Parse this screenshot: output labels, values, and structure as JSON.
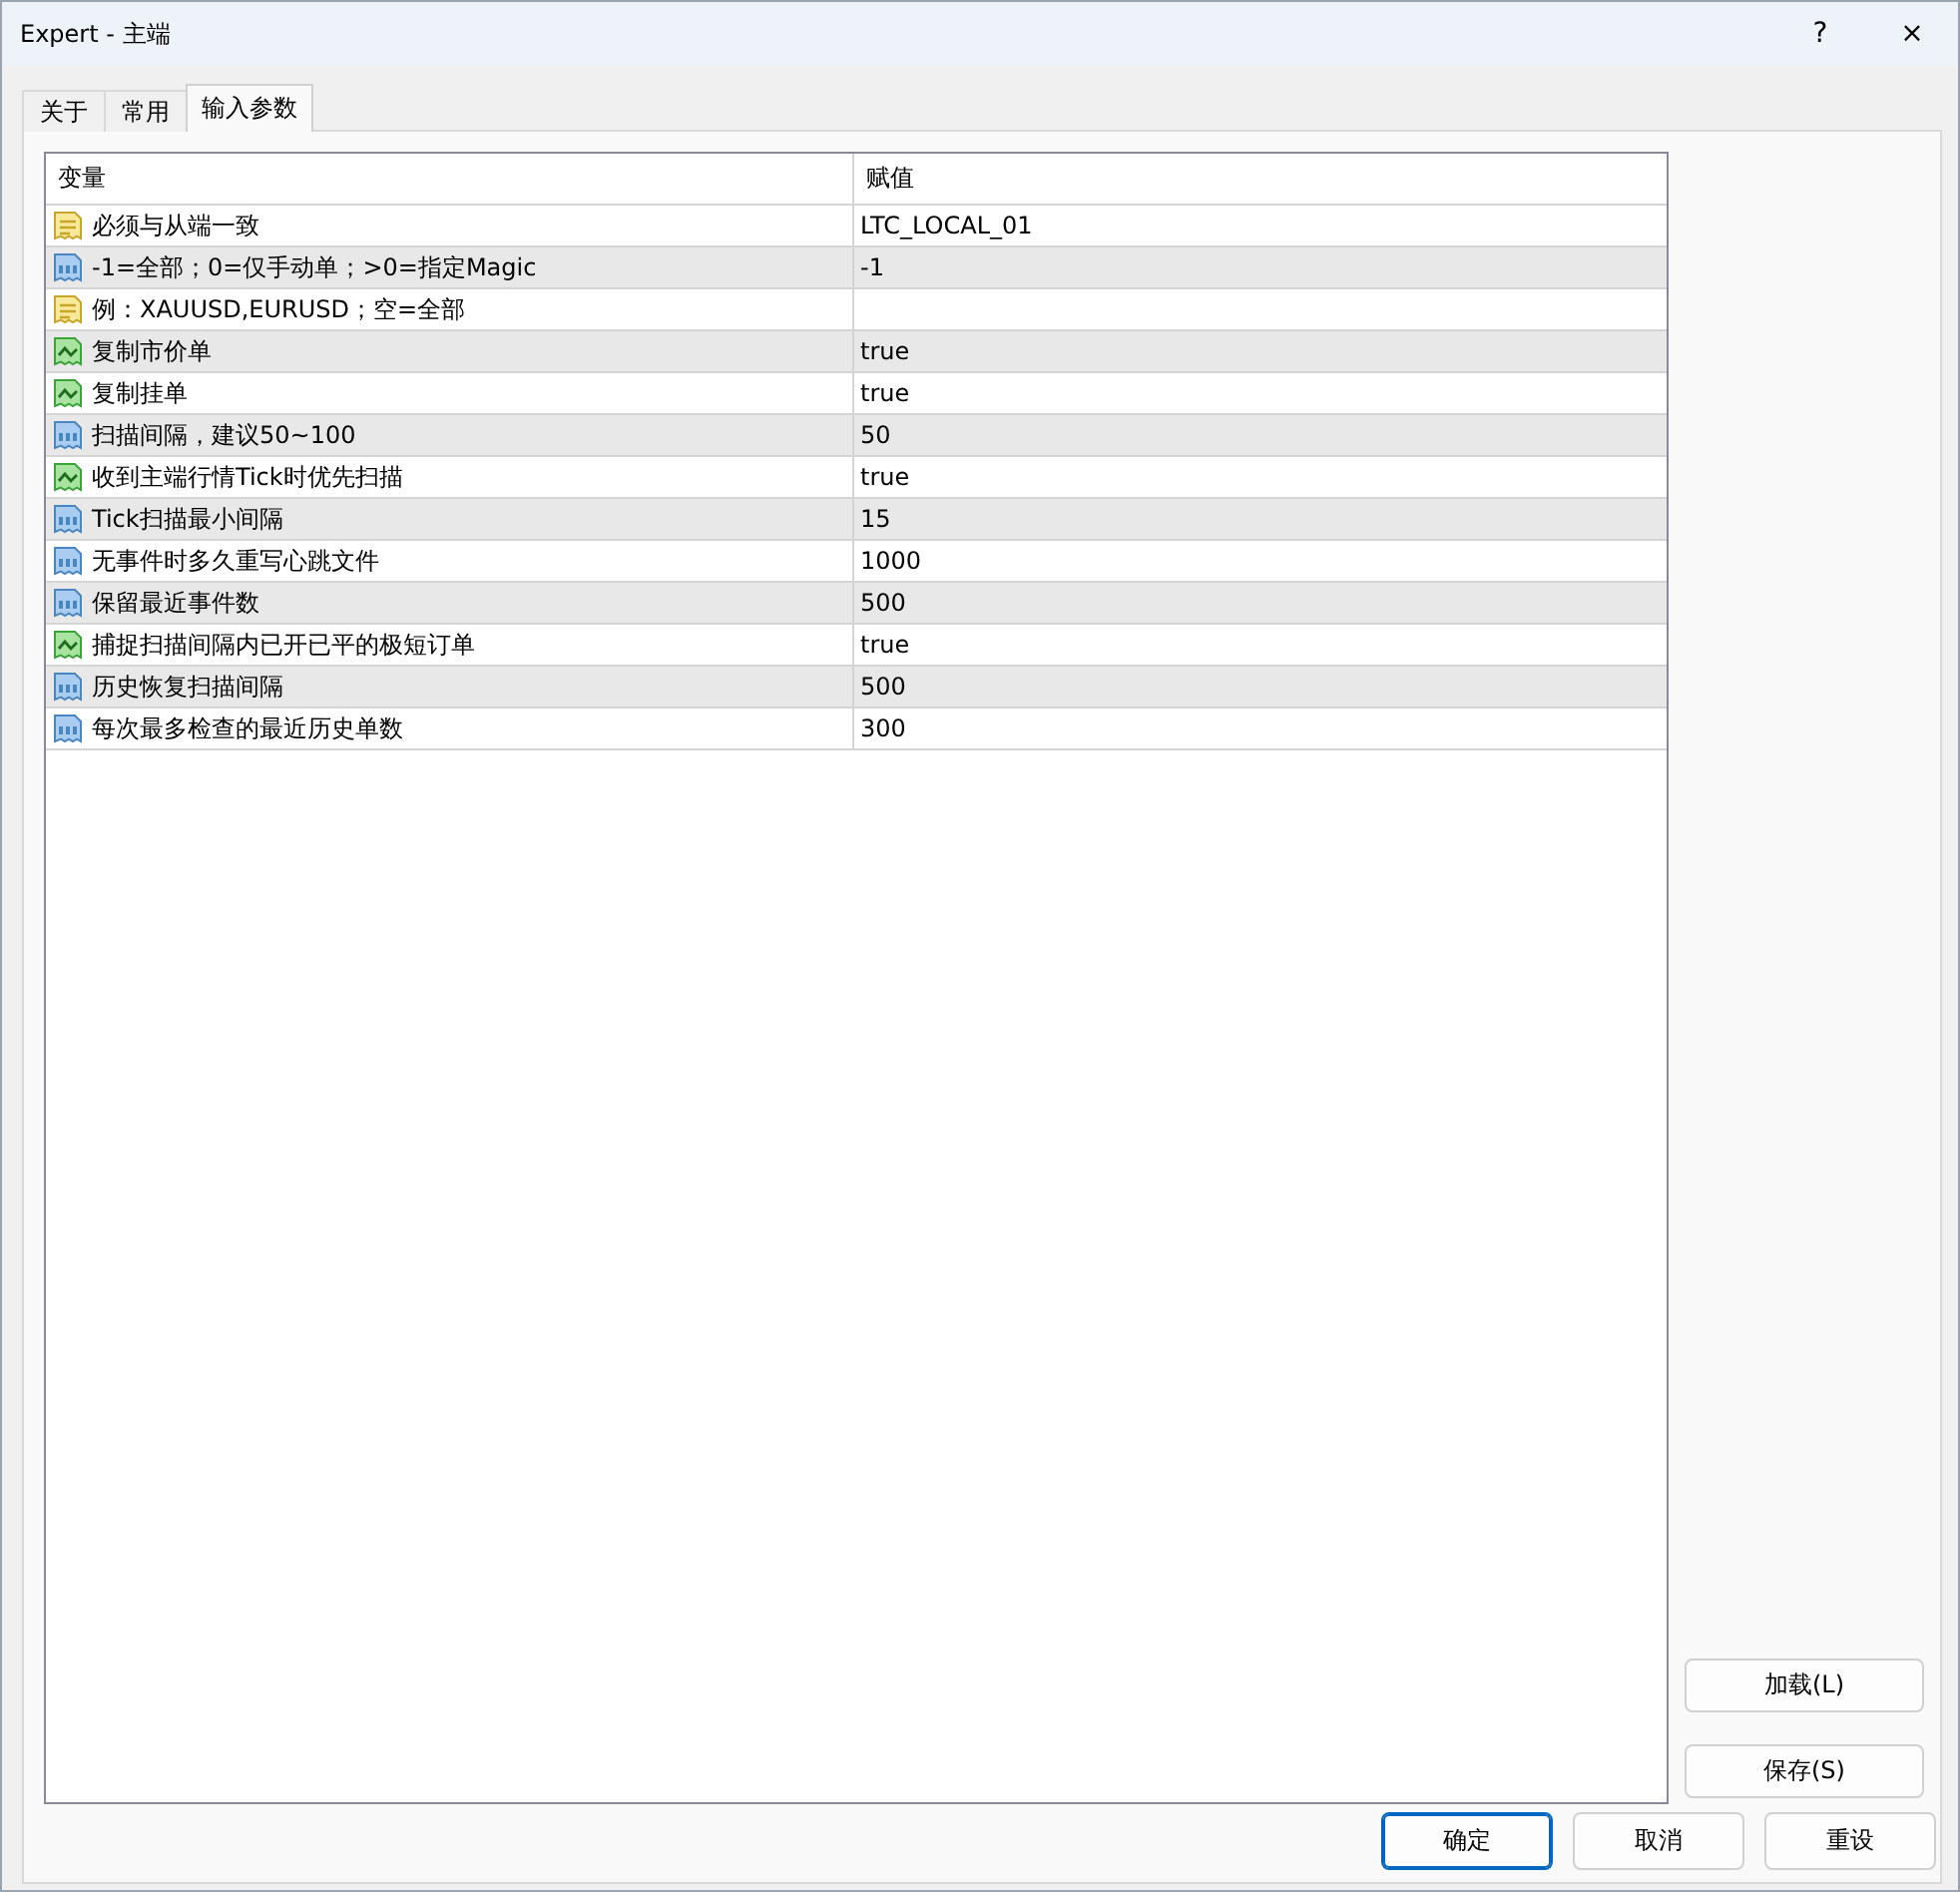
{
  "window": {
    "title": "Expert - 主端",
    "help": "?",
    "close": "×"
  },
  "tabs": [
    {
      "label": "关于",
      "selected": false
    },
    {
      "label": "常用",
      "selected": false
    },
    {
      "label": "输入参数",
      "selected": true
    }
  ],
  "table": {
    "columns": [
      "变量",
      "赋值"
    ],
    "rows": [
      {
        "kind": "string",
        "name": "必须与从端一致",
        "value": "LTC_LOCAL_01"
      },
      {
        "kind": "number",
        "name": "-1=全部；0=仅手动单；>0=指定Magic",
        "value": "-1"
      },
      {
        "kind": "string",
        "name": "例：XAUUSD,EURUSD；空=全部"
      },
      {
        "kind": "bool",
        "name": "复制市价单",
        "value": "true"
      },
      {
        "kind": "bool",
        "name": "复制挂单",
        "value": "true"
      },
      {
        "kind": "number",
        "name": "扫描间隔，建议50~100",
        "value": "50"
      },
      {
        "kind": "bool",
        "name": "收到主端行情Tick时优先扫描",
        "value": "true"
      },
      {
        "kind": "number",
        "name": "Tick扫描最小间隔",
        "value": "15"
      },
      {
        "kind": "number",
        "name": "无事件时多久重写心跳文件",
        "value": "1000"
      },
      {
        "kind": "number",
        "name": "保留最近事件数",
        "value": "500"
      },
      {
        "kind": "bool",
        "name": "捕捉扫描间隔内已开已平的极短订单",
        "value": "true"
      },
      {
        "kind": "number",
        "name": "历史恢复扫描间隔",
        "value": "500"
      },
      {
        "kind": "number",
        "name": "每次最多检查的最近历史单数",
        "value": "300"
      }
    ]
  },
  "side_buttons": [
    "加载(L)",
    "保存(S)"
  ],
  "buttons": [
    {
      "label": "确定",
      "default": true
    },
    {
      "label": "取消",
      "default": false
    },
    {
      "label": "重设",
      "default": false
    }
  ]
}
